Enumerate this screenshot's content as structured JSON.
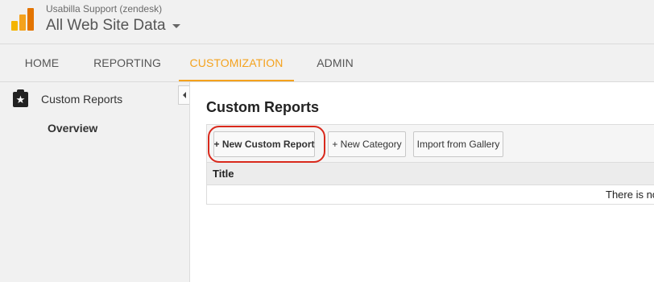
{
  "header": {
    "account_name": "Usabilla Support (zendesk)",
    "property_name": "All Web Site Data",
    "logo_icon": "analytics-logo-icon",
    "logo_colors": [
      "#f4b400",
      "#f4a21d",
      "#e37400"
    ]
  },
  "nav": {
    "tabs": [
      {
        "label": "HOME",
        "active": false
      },
      {
        "label": "REPORTING",
        "active": false
      },
      {
        "label": "CUSTOMIZATION",
        "active": true
      },
      {
        "label": "ADMIN",
        "active": false
      }
    ],
    "accent_color": "#f4a21d"
  },
  "sidebar": {
    "item": {
      "label": "Custom Reports",
      "icon": "star-icon"
    },
    "sub_item": {
      "label": "Overview"
    },
    "collapse_icon": "collapse-left-icon"
  },
  "main": {
    "title": "Custom Reports",
    "toolbar": {
      "new_report": "+ New Custom Report",
      "new_category": "+ New Category",
      "import_gallery": "Import from Gallery"
    },
    "table": {
      "columns": [
        "Title"
      ],
      "empty_message": "There is no"
    },
    "highlight_color": "#d9291c"
  }
}
